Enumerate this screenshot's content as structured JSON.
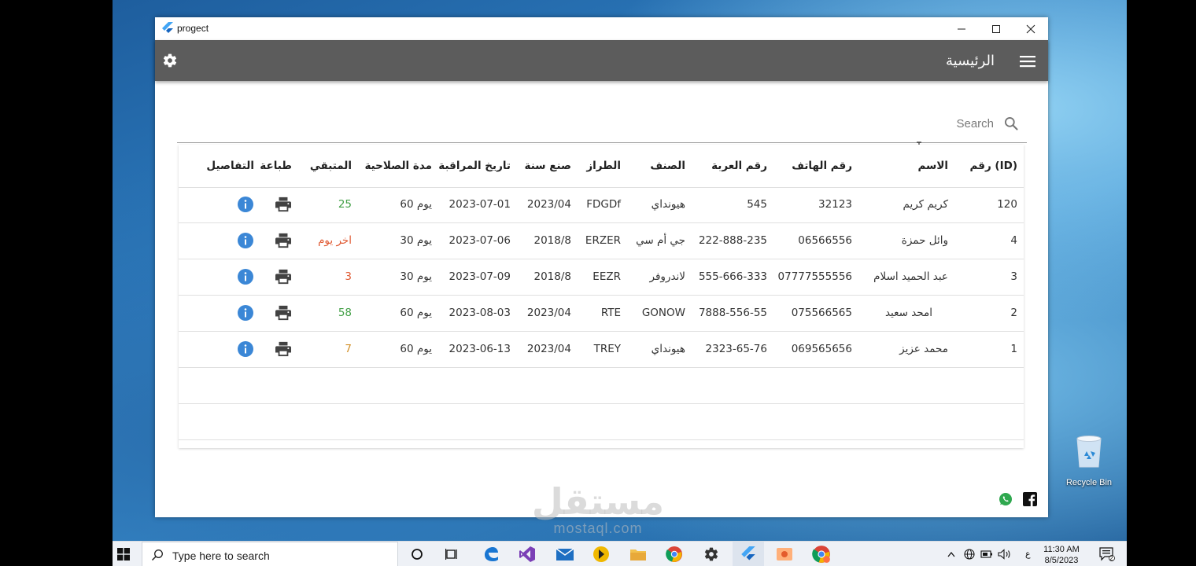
{
  "window": {
    "title": "progect",
    "colors": {
      "appbar": "#5c5c5c",
      "info": "#3b87d6",
      "remain_green": "#43a047",
      "remain_red": "#e05a33",
      "remain_orange": "#d3922c"
    }
  },
  "appbar": {
    "title": "الرئيسية",
    "left_icon": "gear-icon",
    "right_icon": "menu-icon"
  },
  "search": {
    "placeholder": "Search",
    "icon": "search-icon"
  },
  "table": {
    "headers": {
      "id": "رقم (ID)",
      "name": "الاسم",
      "phone": "رقم الهاتف",
      "car_number": "رقم العربة",
      "class": "الصنف",
      "model": "الطراز",
      "year": "صنع سنة",
      "monitor_date": "تاريخ المراقبة",
      "validity": "مدة الصلاحية",
      "remaining": "المتبقي",
      "print": "طباعة",
      "details": "التفاصيل"
    },
    "rows": [
      {
        "id": "120",
        "name": "كريم كريم",
        "phone": "32123",
        "car_number": "545",
        "class": "هيونداي",
        "model": "FDGDf",
        "year": "2023/04",
        "monitor_date": "2023-07-01",
        "validity": "60 يوم",
        "remaining": "25",
        "remaining_status": "green"
      },
      {
        "id": "4",
        "name": "وائل حمزة",
        "phone": "06566556",
        "car_number": "222-888-235",
        "class": "جي أم سي",
        "model": "ERZER",
        "year": "2018/8",
        "monitor_date": "2023-07-06",
        "validity": "30 يوم",
        "remaining": "اخر يوم",
        "remaining_status": "red"
      },
      {
        "id": "3",
        "name": "عبد الحميد اسلام",
        "phone": "07777555556",
        "car_number": "555-666-333",
        "class": "لاندروفر",
        "model": "EEZR",
        "year": "2018/8",
        "monitor_date": "2023-07-09",
        "validity": "30 يوم",
        "remaining": "3",
        "remaining_status": "red"
      },
      {
        "id": "2",
        "name": "امحد سعيد",
        "phone": "075566565",
        "car_number": "7888-556-55",
        "class": "GONOW",
        "model": "RTE",
        "year": "2023/04",
        "monitor_date": "2023-08-03",
        "validity": "60 يوم",
        "remaining": "58",
        "remaining_status": "green"
      },
      {
        "id": "1",
        "name": "محمد عزيز",
        "phone": "069565656",
        "car_number": "2323-65-76",
        "class": "هيونداي",
        "model": "TREY",
        "year": "2023/04",
        "monitor_date": "2023-06-13",
        "validity": "60 يوم",
        "remaining": "7",
        "remaining_status": "orange"
      }
    ],
    "row_icons": {
      "print": "print-icon",
      "details": "info-icon"
    }
  },
  "footer_icons": [
    "whatsapp-icon",
    "facebook-icon"
  ],
  "watermark": {
    "main": "مستقل",
    "sub": "mostaql.com"
  },
  "desktop": {
    "recycle_bin_label": "Recycle Bin"
  },
  "taskbar": {
    "search_placeholder": "Type here to search",
    "language": "ع",
    "time": "11:30 AM",
    "date": "8/5/2023",
    "notification_count": "2"
  }
}
